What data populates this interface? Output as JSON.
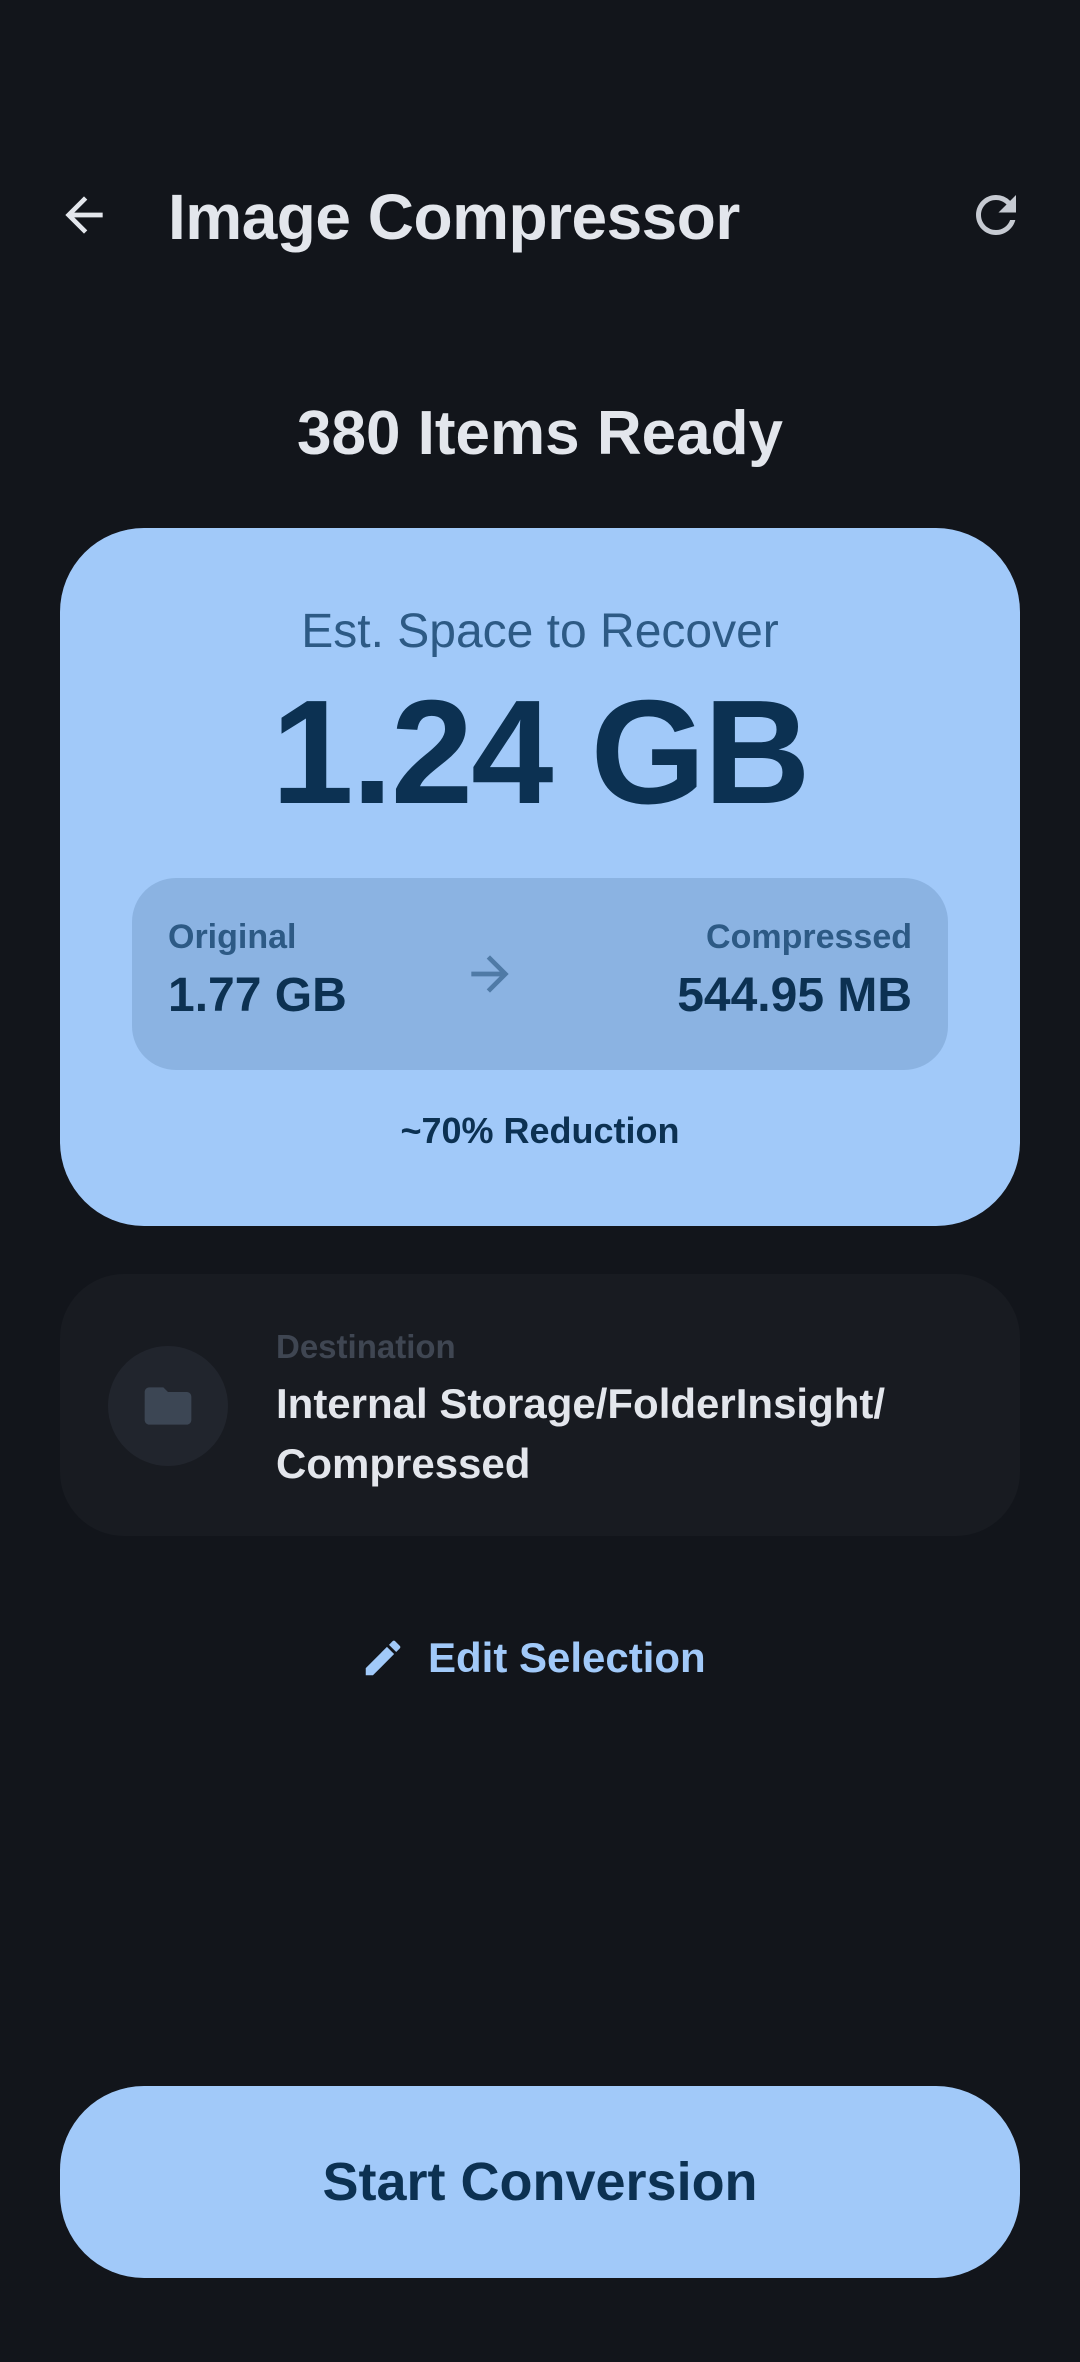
{
  "app_bar": {
    "title": "Image Compressor",
    "back_icon": "arrow-back-icon",
    "refresh_icon": "refresh-icon"
  },
  "summary": {
    "heading": "380 Items Ready",
    "est_label": "Est. Space to Recover",
    "est_value": "1.24 GB",
    "original_label": "Original",
    "original_value": "1.77 GB",
    "compressed_label": "Compressed",
    "compressed_value": "544.95 MB",
    "reduction": "~70% Reduction"
  },
  "destination": {
    "label": "Destination",
    "path": "Internal Storage/FolderInsight/ Compressed",
    "icon": "folder-icon"
  },
  "edit_selection": {
    "label": "Edit Selection",
    "icon": "pencil-icon"
  },
  "start_button": {
    "label": "Start Conversion"
  },
  "colors": {
    "background": "#12151b",
    "card": "#a1c9f9",
    "card_inner": "#8bb3e2",
    "on_card": "#0c3152",
    "dest_card": "#181b21",
    "accent": "#a1c9f9"
  }
}
